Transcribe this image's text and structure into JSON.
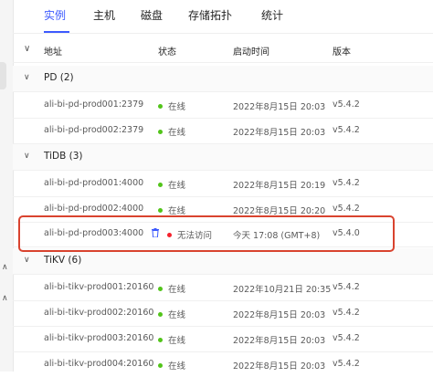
{
  "tabs": [
    "实例",
    "主机",
    "磁盘",
    "存储拓扑",
    "统计"
  ],
  "colors": {
    "accent": "#3d5afe",
    "online": "#52c41a",
    "offline": "#f5222d",
    "highlight": "#d9432f"
  },
  "columns": {
    "address": "地址",
    "status": "状态",
    "start_time": "启动时间",
    "version": "版本"
  },
  "groups": [
    {
      "name": "PD (2)",
      "items": [
        {
          "address": "ali-bi-pd-prod001:2379",
          "status": "在线",
          "start_time": "2022年8月15日 20:03",
          "version": "v5.4.2"
        },
        {
          "address": "ali-bi-pd-prod002:2379",
          "status": "在线",
          "start_time": "2022年8月15日 20:03",
          "version": "v5.4.2"
        }
      ]
    },
    {
      "name": "TiDB (3)",
      "items": [
        {
          "address": "ali-bi-pd-prod001:4000",
          "status": "在线",
          "start_time": "2022年8月15日 20:19",
          "version": "v5.4.2"
        },
        {
          "address": "ali-bi-pd-prod002:4000",
          "status": "在线",
          "start_time": "2022年8月15日 20:20",
          "version": "v5.4.2"
        },
        {
          "address": "ali-bi-pd-prod003:4000",
          "status": "无法访问",
          "start_time": "今天 17:08 (GMT+8)",
          "version": "v5.4.0"
        }
      ]
    },
    {
      "name": "TiKV (6)",
      "items": [
        {
          "address": "ali-bi-tikv-prod001:20160",
          "status": "在线",
          "start_time": "2022年10月21日 20:35",
          "version": "v5.4.2"
        },
        {
          "address": "ali-bi-tikv-prod002:20160",
          "status": "在线",
          "start_time": "2022年8月15日 20:03",
          "version": "v5.4.2"
        },
        {
          "address": "ali-bi-tikv-prod003:20160",
          "status": "在线",
          "start_time": "2022年8月15日 20:03",
          "version": "v5.4.2"
        },
        {
          "address": "ali-bi-tikv-prod004:20160",
          "status": "在线",
          "start_time": "2022年8月15日 20:03",
          "version": "v5.4.2"
        }
      ]
    }
  ]
}
